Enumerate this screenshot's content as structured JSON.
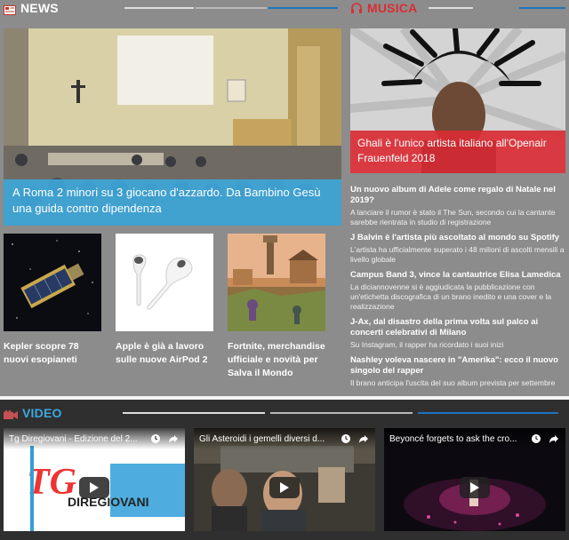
{
  "news": {
    "title": "NEWS",
    "hero": {
      "caption": "A Roma 2 minori su 3 giocano d'azzardo. Da Bambino Gesù una guida contro dipendenza"
    },
    "thumbs": [
      {
        "caption": "Kepler scopre 78 nuovi esopianeti"
      },
      {
        "caption": "Apple è già a lavoro sulle nuove AirPod 2"
      },
      {
        "caption": "Fortnite, merchandise ufficiale e novità per Salva il Mondo"
      }
    ]
  },
  "music": {
    "title": "MUSICA",
    "hero": {
      "caption": "Ghali è l'unico artista italiano all'Openair Frauenfeld 2018"
    },
    "items": [
      {
        "title": "Un nuovo album di Adele come regalo di Natale nel 2019?",
        "desc": "A lanciare il rumor è stato il The Sun, secondo cui la cantante sarebbe rientrata in studio di registrazione"
      },
      {
        "title": "J Balvin è l'artista più ascoltato al mondo su Spotify",
        "desc": "L'artista ha ufficialmente superato i 48 milioni di ascolti mensili a livello globale"
      },
      {
        "title": "Campus Band 3, vince la cantautrice Elisa Lamedica",
        "desc": "La diciannovenne si è aggiudicata la pubblicazione con un'etichetta discografica di un brano inedito e una cover e la realizzazione"
      },
      {
        "title": "J-Ax, dal disastro della prima volta sul palco ai concerti celebrativi di Milano",
        "desc": "Su Instagram, il rapper ha ricordato i suoi inizi"
      },
      {
        "title": "Nashley voleva nascere in \"Amerika\": ecco il nuovo singolo del rapper",
        "desc": "Il brano anticipa l'uscita del suo album prevista per settembre"
      }
    ]
  },
  "video": {
    "title": "VIDEO",
    "items": [
      {
        "title": "Tg Diregiovani - Edizione del 2..."
      },
      {
        "title": "Gli Asteroidi i gemelli diversi d..."
      },
      {
        "title": "Beyoncé forgets to ask the cro..."
      }
    ],
    "tg_logo_text": "DIREGIOVANI"
  },
  "colors": {
    "news_accent": "#3ba8de",
    "music_accent": "#d92d34",
    "blue_line": "#1e73be"
  }
}
